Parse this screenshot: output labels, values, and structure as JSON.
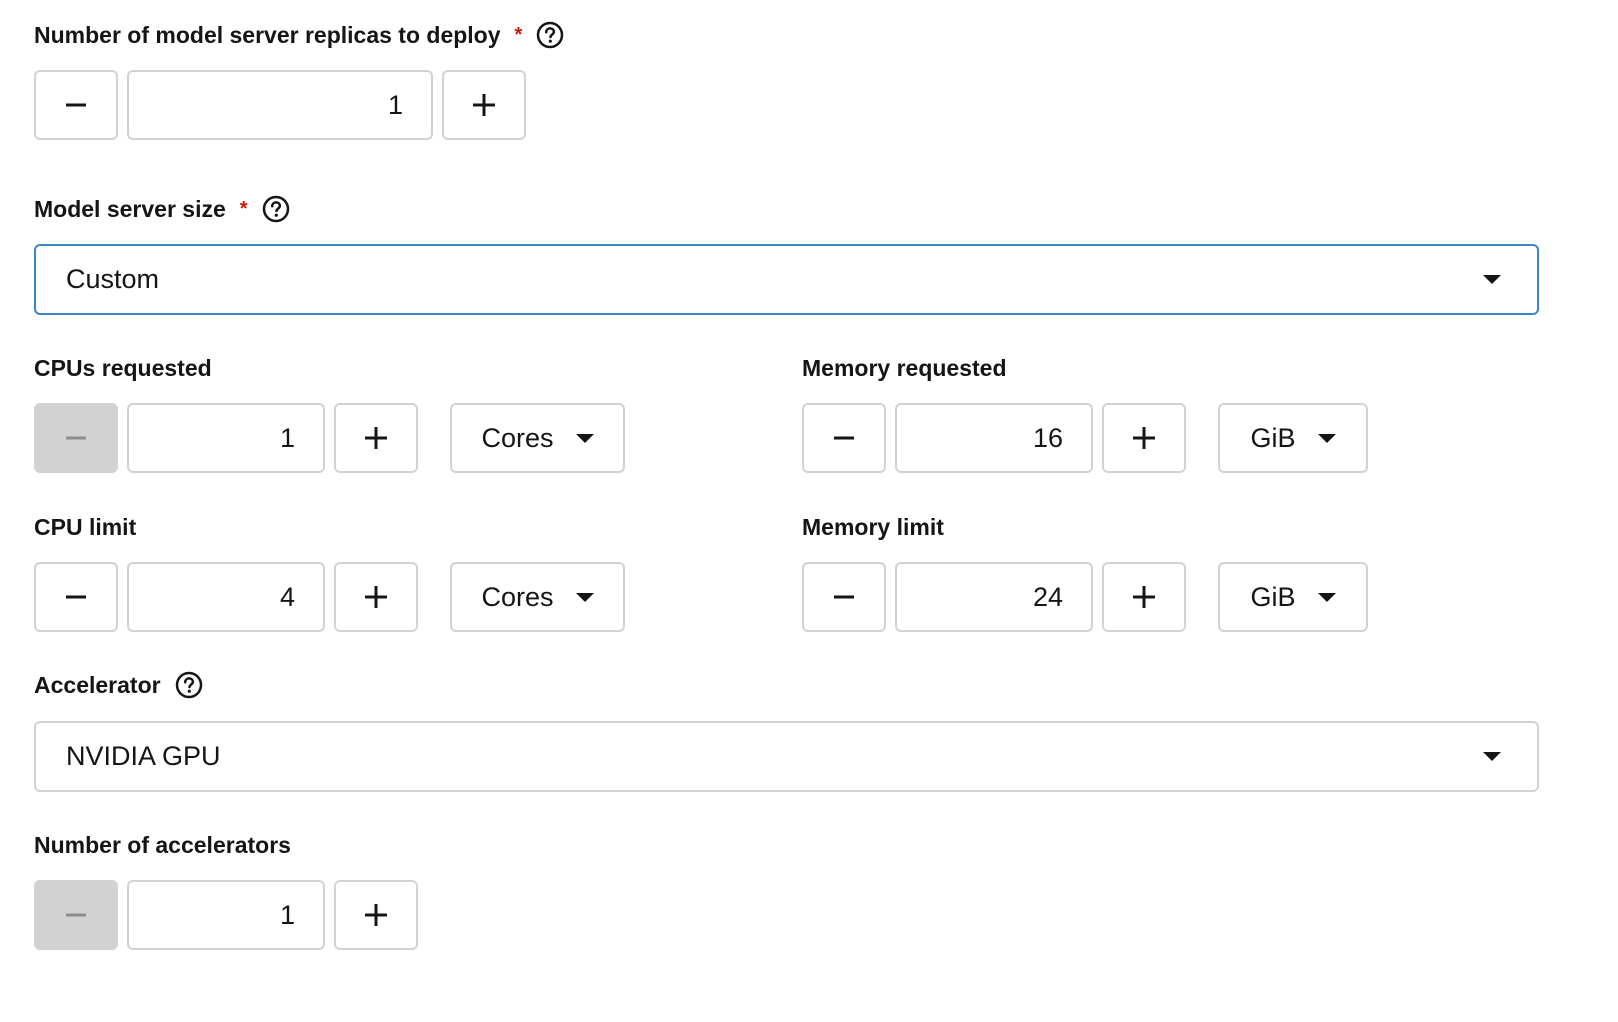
{
  "replicas": {
    "label": "Number of model server replicas to deploy",
    "required_mark": "*",
    "value": "1",
    "minus_icon": "minus-icon",
    "plus_icon": "plus-icon"
  },
  "server_size": {
    "label": "Model server size",
    "required_mark": "*",
    "selected": "Custom"
  },
  "cpu_requested": {
    "label": "CPUs requested",
    "value": "1",
    "unit": "Cores",
    "minus_disabled": true
  },
  "memory_requested": {
    "label": "Memory requested",
    "value": "16",
    "unit": "GiB"
  },
  "cpu_limit": {
    "label": "CPU limit",
    "value": "4",
    "unit": "Cores"
  },
  "memory_limit": {
    "label": "Memory limit",
    "value": "24",
    "unit": "GiB"
  },
  "accelerator": {
    "label": "Accelerator",
    "selected": "NVIDIA GPU"
  },
  "num_accelerators": {
    "label": "Number of accelerators",
    "value": "1",
    "minus_disabled": true
  },
  "colors": {
    "required": "#c9190b",
    "focus_border": "#3e84c8",
    "border": "#d2d2d2",
    "disabled_bg": "#d2d2d2",
    "text": "#151515"
  }
}
